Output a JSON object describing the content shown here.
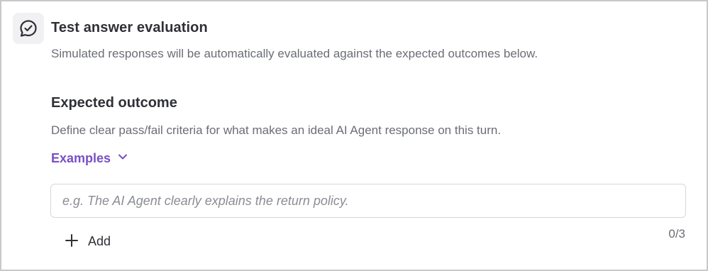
{
  "header": {
    "icon": "chat-check-icon",
    "title": "Test answer evaluation",
    "subtitle": "Simulated responses will be automatically evaluated against the expected outcomes below."
  },
  "expected_outcome": {
    "title": "Expected outcome",
    "description": "Define clear pass/fail criteria for what makes an ideal AI Agent response on this turn.",
    "examples_label": "Examples",
    "examples_icon": "chevron-down-icon",
    "input_value": "",
    "input_placeholder": "e.g. The AI Agent clearly explains the return policy.",
    "add_label": "Add",
    "add_icon": "plus-icon",
    "counter": "0/3"
  },
  "colors": {
    "accent": "#7a4fc4",
    "text_primary": "#2f3037",
    "text_secondary": "#6b6d76",
    "border": "#d6d7db"
  }
}
